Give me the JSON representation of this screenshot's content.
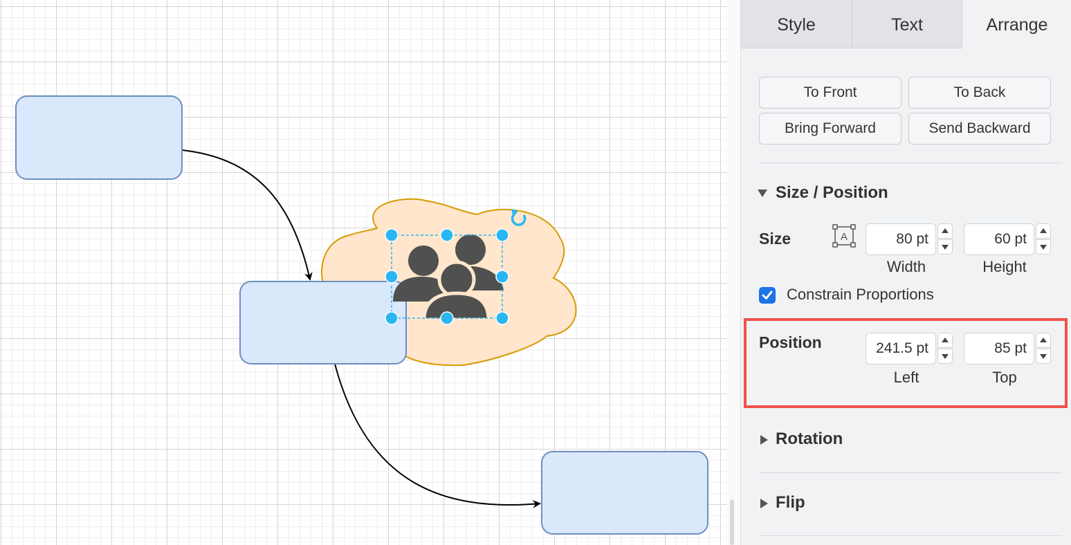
{
  "tabs": {
    "style": "Style",
    "text": "Text",
    "arrange": "Arrange"
  },
  "arrange_buttons": {
    "to_front": "To Front",
    "to_back": "To Back",
    "bring_forward": "Bring Forward",
    "send_backward": "Send Backward"
  },
  "size_position": {
    "section_title": "Size / Position",
    "size_label": "Size",
    "width_value": "80 pt",
    "width_label": "Width",
    "height_value": "60 pt",
    "height_label": "Height",
    "constrain_label": "Constrain Proportions",
    "constrain_checked": true,
    "position_label": "Position",
    "left_value": "241.5 pt",
    "left_label": "Left",
    "top_value": "85 pt",
    "top_label": "Top"
  },
  "sections": {
    "rotation": "Rotation",
    "flip": "Flip"
  },
  "colors": {
    "shape_fill": "#dae8fc",
    "shape_stroke": "#6c8ebf",
    "cloud_fill": "#ffe6cc",
    "cloud_stroke": "#d79b00",
    "selection": "#29b6f2",
    "highlight": "#f0524d",
    "checkbox": "#1a73e8"
  },
  "icons": {
    "users_icon": "users-group-icon",
    "rotate_handle": "rotate-icon",
    "size_icon": "resize-text-icon"
  }
}
